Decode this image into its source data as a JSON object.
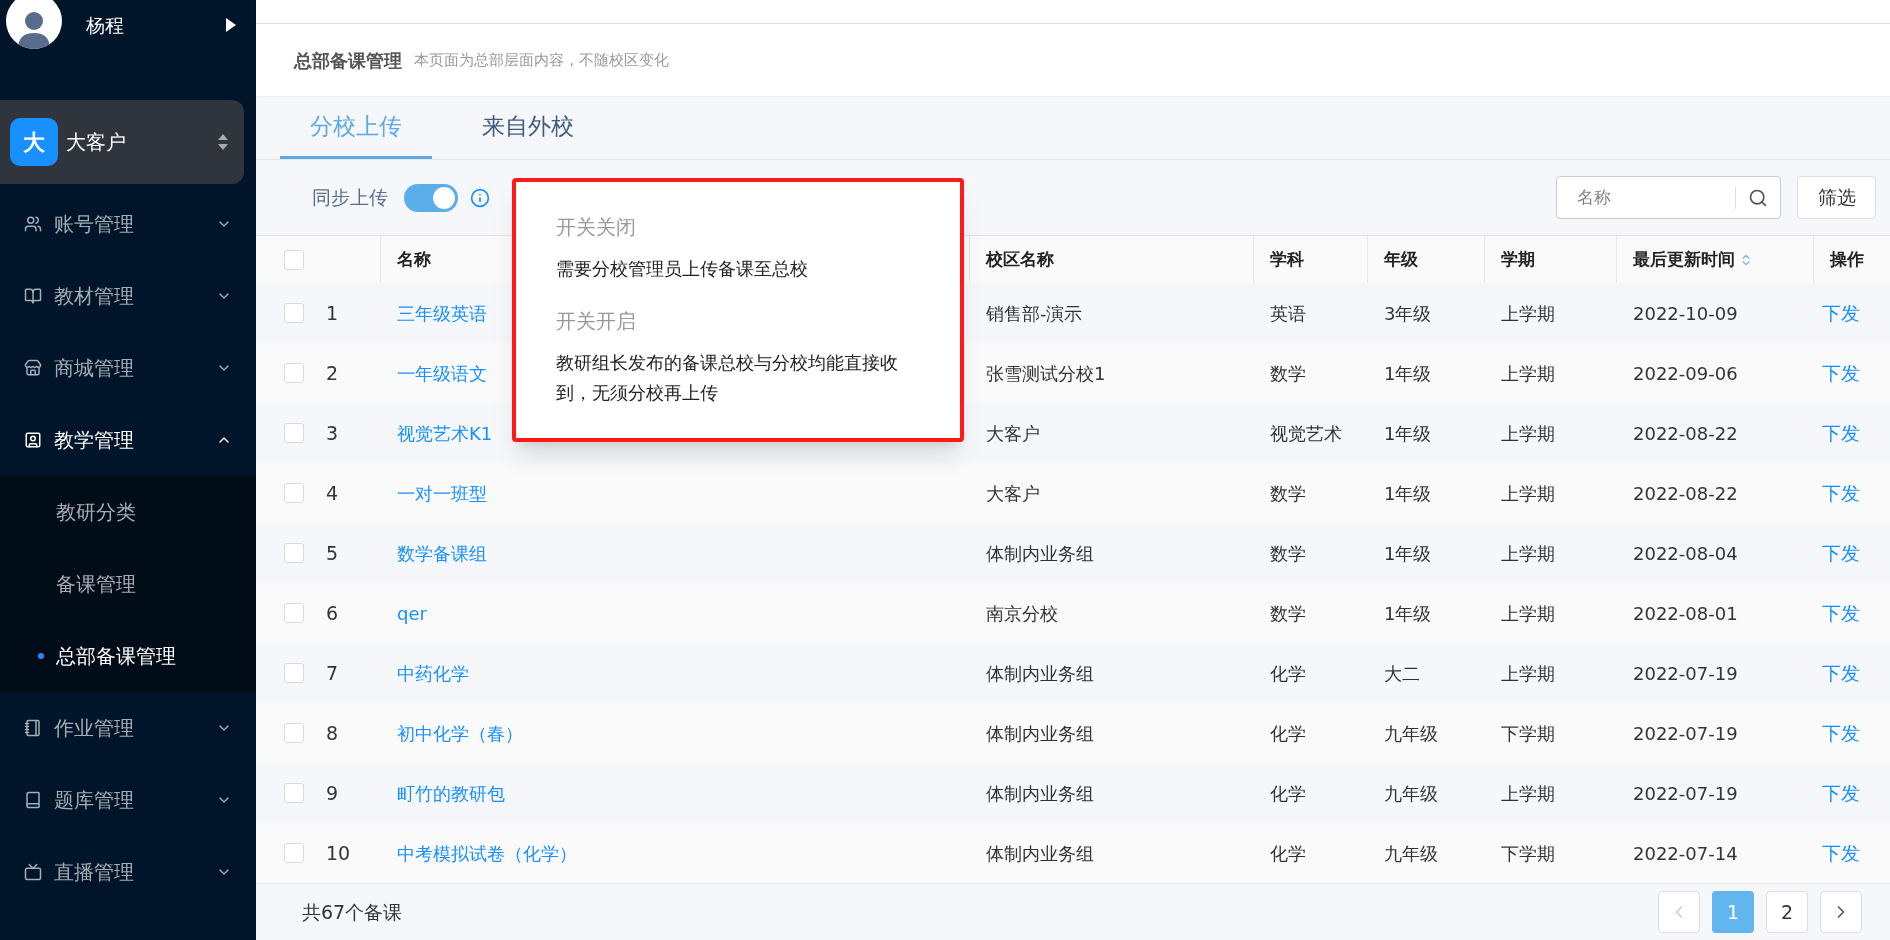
{
  "user": {
    "name": "杨程"
  },
  "tenant": {
    "badge": "大",
    "name": "大客户"
  },
  "sidebar": {
    "items": [
      {
        "label": "账号管理",
        "expanded": false
      },
      {
        "label": "教材管理",
        "expanded": false
      },
      {
        "label": "商城管理",
        "expanded": false
      },
      {
        "label": "教学管理",
        "expanded": true,
        "children": [
          {
            "label": "教研分类",
            "selected": false
          },
          {
            "label": "备课管理",
            "selected": false
          },
          {
            "label": "总部备课管理",
            "selected": true
          }
        ]
      },
      {
        "label": "作业管理",
        "expanded": false
      },
      {
        "label": "题库管理",
        "expanded": false
      },
      {
        "label": "直播管理",
        "expanded": false
      }
    ]
  },
  "page": {
    "title": "总部备课管理",
    "subtitle": "本页面为总部层面内容，不随校区变化"
  },
  "tabs": [
    {
      "label": "分校上传",
      "selected": true
    },
    {
      "label": "来自外校",
      "selected": false
    }
  ],
  "sync": {
    "label": "同步上传",
    "on": true
  },
  "popover": {
    "sections": [
      {
        "title": "开关关闭",
        "text": "需要分校管理员上传备课至总校"
      },
      {
        "title": "开关开启",
        "text": "教研组长发布的备课总校与分校均能直接收到，无须分校再上传"
      }
    ]
  },
  "search": {
    "placeholder": "名称"
  },
  "filter_button": "筛选",
  "table": {
    "select_all_checked": false,
    "columns": [
      "名称",
      "校区名称",
      "学科",
      "年级",
      "学期",
      "最后更新时间",
      "操作"
    ],
    "rows": [
      {
        "index": "1",
        "name": "三年级英语",
        "campus": "销售部-演示",
        "subject": "英语",
        "grade": "3年级",
        "term": "上学期",
        "updated": "2022-10-09",
        "action": "下发",
        "checked": false
      },
      {
        "index": "2",
        "name": "一年级语文",
        "campus": "张雪测试分校1",
        "subject": "数学",
        "grade": "1年级",
        "term": "上学期",
        "updated": "2022-09-06",
        "action": "下发",
        "checked": false
      },
      {
        "index": "3",
        "name": "视觉艺术K1",
        "campus": "大客户",
        "subject": "视觉艺术",
        "grade": "1年级",
        "term": "上学期",
        "updated": "2022-08-22",
        "action": "下发",
        "checked": false
      },
      {
        "index": "4",
        "name": "一对一班型",
        "campus": "大客户",
        "subject": "数学",
        "grade": "1年级",
        "term": "上学期",
        "updated": "2022-08-22",
        "action": "下发",
        "checked": false
      },
      {
        "index": "5",
        "name": "数学备课组",
        "campus": "体制内业务组",
        "subject": "数学",
        "grade": "1年级",
        "term": "上学期",
        "updated": "2022-08-04",
        "action": "下发",
        "checked": false
      },
      {
        "index": "6",
        "name": "qer",
        "campus": "南京分校",
        "subject": "数学",
        "grade": "1年级",
        "term": "上学期",
        "updated": "2022-08-01",
        "action": "下发",
        "checked": false
      },
      {
        "index": "7",
        "name": "中药化学",
        "campus": "体制内业务组",
        "subject": "化学",
        "grade": "大二",
        "term": "上学期",
        "updated": "2022-07-19",
        "action": "下发",
        "checked": false
      },
      {
        "index": "8",
        "name": "初中化学（春）",
        "campus": "体制内业务组",
        "subject": "化学",
        "grade": "九年级",
        "term": "下学期",
        "updated": "2022-07-19",
        "action": "下发",
        "checked": false
      },
      {
        "index": "9",
        "name": "町竹的教研包",
        "campus": "体制内业务组",
        "subject": "化学",
        "grade": "九年级",
        "term": "上学期",
        "updated": "2022-07-19",
        "action": "下发",
        "checked": false
      },
      {
        "index": "10",
        "name": "中考模拟试卷（化学）",
        "campus": "体制内业务组",
        "subject": "化学",
        "grade": "九年级",
        "term": "下学期",
        "updated": "2022-07-14",
        "action": "下发",
        "checked": false
      }
    ]
  },
  "footer": {
    "total": "共67个备课"
  },
  "pagination": {
    "pages": [
      {
        "label": "1",
        "selected": true
      },
      {
        "label": "2",
        "selected": false
      }
    ]
  }
}
